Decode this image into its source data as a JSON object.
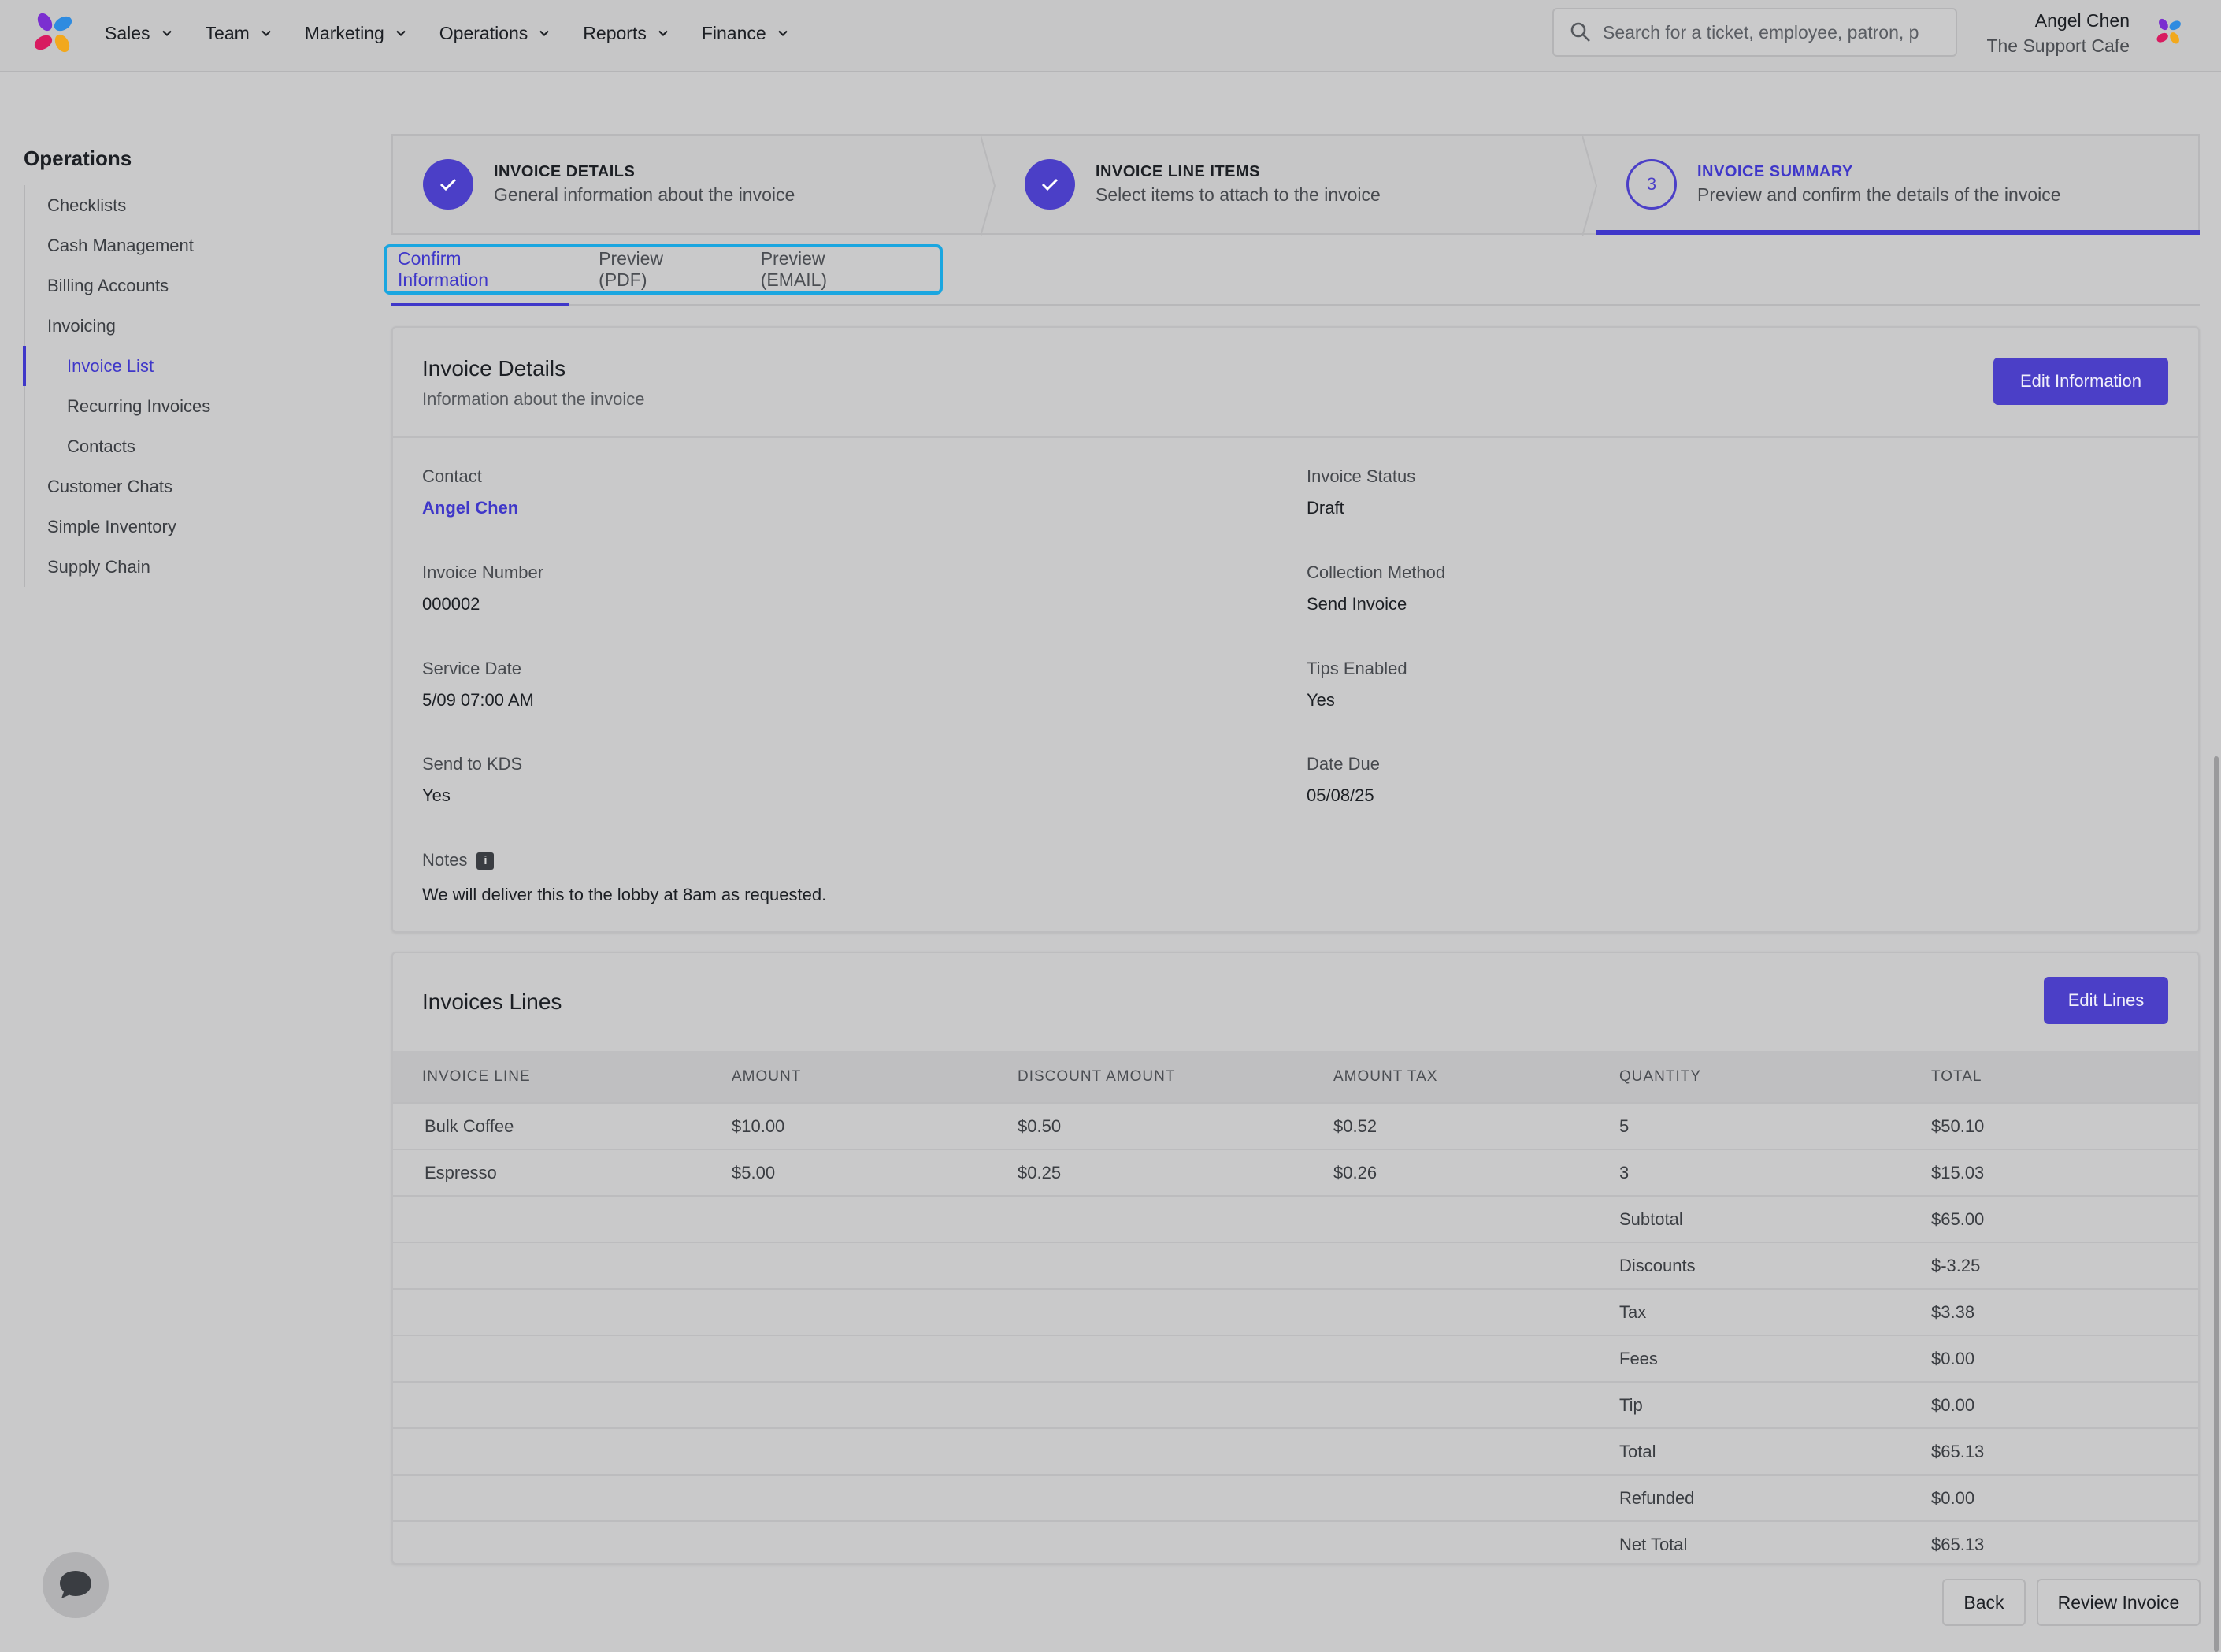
{
  "nav": {
    "items": [
      {
        "label": "Sales"
      },
      {
        "label": "Team"
      },
      {
        "label": "Marketing"
      },
      {
        "label": "Operations"
      },
      {
        "label": "Reports"
      },
      {
        "label": "Finance"
      }
    ],
    "search_placeholder": "Search for a ticket, employee, patron, p",
    "user_name": "Angel Chen",
    "user_org": "The Support Cafe"
  },
  "sidebar": {
    "title": "Operations",
    "items": [
      {
        "label": "Checklists"
      },
      {
        "label": "Cash Management"
      },
      {
        "label": "Billing Accounts"
      },
      {
        "label": "Invoicing"
      },
      {
        "label": "Invoice List"
      },
      {
        "label": "Recurring Invoices"
      },
      {
        "label": "Contacts"
      },
      {
        "label": "Customer Chats"
      },
      {
        "label": "Simple Inventory"
      },
      {
        "label": "Supply Chain"
      }
    ]
  },
  "stepper": {
    "steps": [
      {
        "title": "INVOICE DETAILS",
        "desc": "General information about the invoice",
        "state": "complete"
      },
      {
        "title": "INVOICE LINE ITEMS",
        "desc": "Select items to attach to the invoice",
        "state": "complete"
      },
      {
        "title": "INVOICE SUMMARY",
        "desc": "Preview and confirm the details of the invoice",
        "number": "3",
        "state": "current"
      }
    ]
  },
  "tabs": [
    {
      "label": "Confirm Information"
    },
    {
      "label": "Preview (PDF)"
    },
    {
      "label": "Preview (EMAIL)"
    }
  ],
  "details": {
    "title": "Invoice Details",
    "subtitle": "Information about the invoice",
    "edit_label": "Edit Information",
    "contact_label": "Contact",
    "contact_value": "Angel Chen",
    "status_label": "Invoice Status",
    "status_value": "Draft",
    "number_label": "Invoice Number",
    "number_value": "000002",
    "method_label": "Collection Method",
    "method_value": "Send Invoice",
    "service_label": "Service Date",
    "service_value": "5/09 07:00 AM",
    "tips_label": "Tips Enabled",
    "tips_value": "Yes",
    "kds_label": "Send to KDS",
    "kds_value": "Yes",
    "due_label": "Date Due",
    "due_value": "05/08/25",
    "notes_label": "Notes",
    "info_glyph": "i",
    "notes_value": "We will deliver this to the lobby at 8am as requested."
  },
  "lines": {
    "title": "Invoices Lines",
    "edit_label": "Edit Lines",
    "headers": [
      "INVOICE LINE",
      "AMOUNT",
      "DISCOUNT AMOUNT",
      "AMOUNT TAX",
      "QUANTITY",
      "TOTAL"
    ],
    "rows": [
      [
        "Bulk Coffee",
        "$10.00",
        "$0.50",
        "$0.52",
        "5",
        "$50.10"
      ],
      [
        "Espresso",
        "$5.00",
        "$0.25",
        "$0.26",
        "3",
        "$15.03"
      ]
    ],
    "summary": [
      {
        "label": "Subtotal",
        "value": "$65.00"
      },
      {
        "label": "Discounts",
        "value": "$-3.25"
      },
      {
        "label": "Tax",
        "value": "$3.38"
      },
      {
        "label": "Fees",
        "value": "$0.00"
      },
      {
        "label": "Tip",
        "value": "$0.00"
      },
      {
        "label": "Total",
        "value": "$65.13"
      },
      {
        "label": "Refunded",
        "value": "$0.00"
      },
      {
        "label": "Net Total",
        "value": "$65.13"
      }
    ]
  },
  "footer": {
    "back_label": "Back",
    "review_label": "Review Invoice"
  },
  "colors": {
    "accent": "#3f37c9",
    "button": "#4b3fc7",
    "focus_ring": "#1aa6e0",
    "background": "#c9c9ca"
  }
}
